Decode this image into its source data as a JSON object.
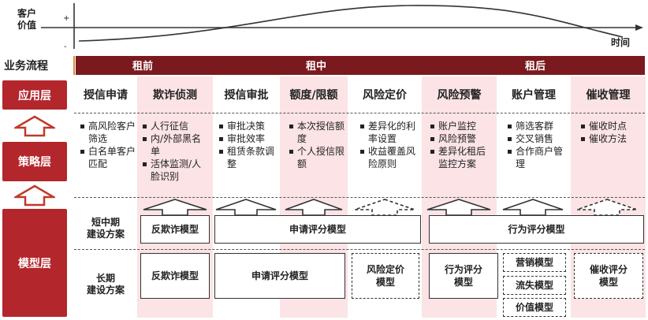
{
  "chart": {
    "y_label": "客户\n价值",
    "plus": "+",
    "minus": "-",
    "x_label": "时间"
  },
  "process_label": "业务流程",
  "phases": [
    "租前",
    "租中",
    "租后"
  ],
  "rows": {
    "app_layer": "应用层",
    "strategy_layer": "策略层",
    "model_layer": "模型层"
  },
  "applications": [
    "授信申请",
    "欺诈侦测",
    "授信审批",
    "额度/限额",
    "风险定价",
    "风险预警",
    "账户管理",
    "催收管理"
  ],
  "strategies": [
    [
      "高风险客户筛选",
      "白名单客户匹配"
    ],
    [
      "人行征信",
      "内/外部黑名单",
      "活体监测/人脸识别"
    ],
    [
      "审批决策",
      "审批效率",
      "租赁条款调整"
    ],
    [
      "本次授信额度",
      "个人授信限额"
    ],
    [
      "差异化的利率设置",
      "收益覆盖风险原则"
    ],
    [
      "账户监控",
      "风险预警",
      "差异化租后监控方案"
    ],
    [
      "筛选客群",
      "交叉销售",
      "合作商户管理"
    ],
    [
      "催收时点",
      "催收方法"
    ]
  ],
  "model_rows": {
    "short_term": "短中期\n建设方案",
    "long_term": "长期\n建设方案"
  },
  "models": {
    "short_fraud": "反欺诈模型",
    "short_application": "申请评分模型",
    "short_behavior": "行为评分模型",
    "long_fraud": "反欺诈模型",
    "long_application": "申请评分模型",
    "long_pricing": "风险定价\n模型",
    "long_behavior": "行为评分\n模型",
    "long_marketing": "营销模型",
    "long_churn": "流失模型",
    "long_value": "价值模型",
    "long_collection": "催收评分\n模型"
  },
  "colors": {
    "accent": "#b3262b",
    "phase_dark": "#7a1a1e",
    "shade": "#fbe3e6"
  }
}
